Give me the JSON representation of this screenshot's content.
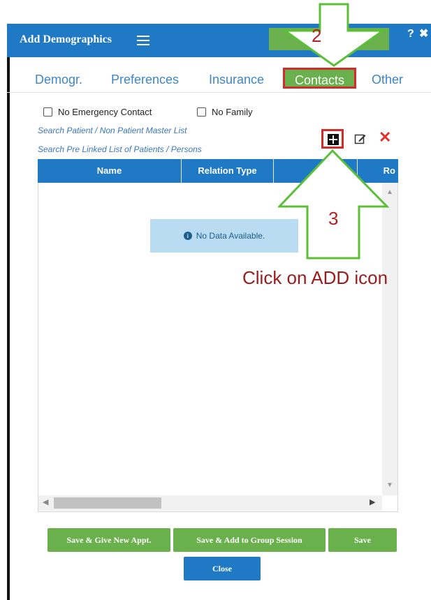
{
  "dialog": {
    "title": "Add Demographics",
    "menu_icon": "hamburger-icon",
    "help_label": "?",
    "close_label": "✖"
  },
  "tabs": [
    {
      "label": "Demogr.",
      "active": false
    },
    {
      "label": "Preferences",
      "active": false
    },
    {
      "label": "Insurance",
      "active": false
    },
    {
      "label": "Contacts",
      "active": true
    },
    {
      "label": "Other",
      "active": false
    }
  ],
  "options": {
    "no_emergency_contact": "No Emergency Contact",
    "no_family": "No Family"
  },
  "links": {
    "search_master": "Search Patient / Non Patient Master List",
    "search_linked": "Search Pre Linked List of Patients / Persons"
  },
  "toolbar": {
    "add_icon": "plus-square-icon",
    "edit_icon": "edit-icon",
    "delete_icon": "delete-x-icon",
    "delete_label": "✕"
  },
  "grid": {
    "columns": [
      "Name",
      "Relation Type",
      "",
      "Ro"
    ],
    "rows": [],
    "empty_message": "No Data Available."
  },
  "annotations": {
    "step2": "2",
    "step3": "3",
    "instruction": "Click on ADD icon"
  },
  "buttons": {
    "save_new_appt": "Save & Give New Appt.",
    "save_group": "Save & Add to Group Session",
    "save": "Save",
    "close": "Close"
  },
  "colors": {
    "primary_blue": "#1f79c4",
    "green": "#6ab04c",
    "highlight_red": "#d42a2a",
    "annotation_arrow": "#5cbf3a"
  }
}
